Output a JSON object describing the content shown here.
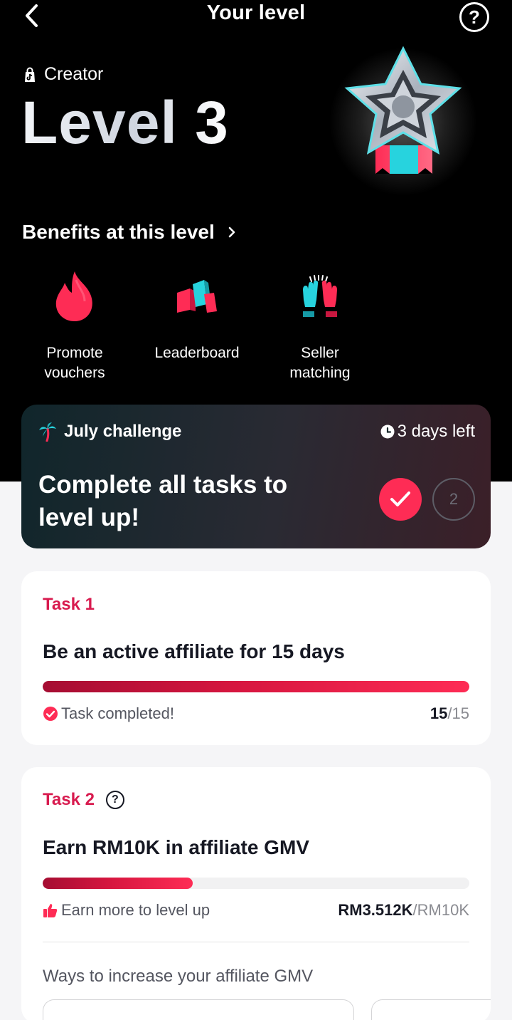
{
  "header": {
    "title": "Your level",
    "back_icon": "chevron-left-icon",
    "help_icon": "question-circle-icon",
    "help_symbol": "?"
  },
  "profile": {
    "role": "Creator",
    "level": "Level 3",
    "badge_icon": "silver-star-medal-icon"
  },
  "benefits": {
    "heading": "Benefits at this level",
    "items": [
      {
        "label_line1": "Promote",
        "label_line2": "vouchers",
        "icon": "flame-icon"
      },
      {
        "label_line1": "Leaderboard",
        "label_line2": "",
        "icon": "leaderboard-blocks-icon"
      },
      {
        "label_line1": "Seller",
        "label_line2": "matching",
        "icon": "high-five-icon"
      }
    ]
  },
  "challenge": {
    "label": "July challenge",
    "time_left": "3 days left",
    "headline_line1": "Complete all tasks to",
    "headline_line2": "level up!",
    "steps": [
      {
        "state": "done",
        "icon": "checkmark-icon"
      },
      {
        "state": "pending",
        "number": "2"
      }
    ]
  },
  "tasks": [
    {
      "label": "Task 1",
      "title": "Be an active affiliate for 15 days",
      "progress": 1.0,
      "status": "Task completed!",
      "status_icon": "check-circle-icon",
      "current": "15",
      "target": "/15"
    },
    {
      "label": "Task 2",
      "has_info": true,
      "info_symbol": "?",
      "title": "Earn RM10K in affiliate GMV",
      "progress": 0.3512,
      "status": "Earn more to level up",
      "status_icon": "thumbs-up-icon",
      "current": "RM3.512K",
      "target": "/RM10K",
      "ways_heading": "Ways to increase your affiliate GMV"
    }
  ],
  "colors": {
    "accent": "#fe2c55",
    "task_label": "#d81b4f",
    "hero_bg": "#000000",
    "page_bg": "#f5f5f7"
  }
}
